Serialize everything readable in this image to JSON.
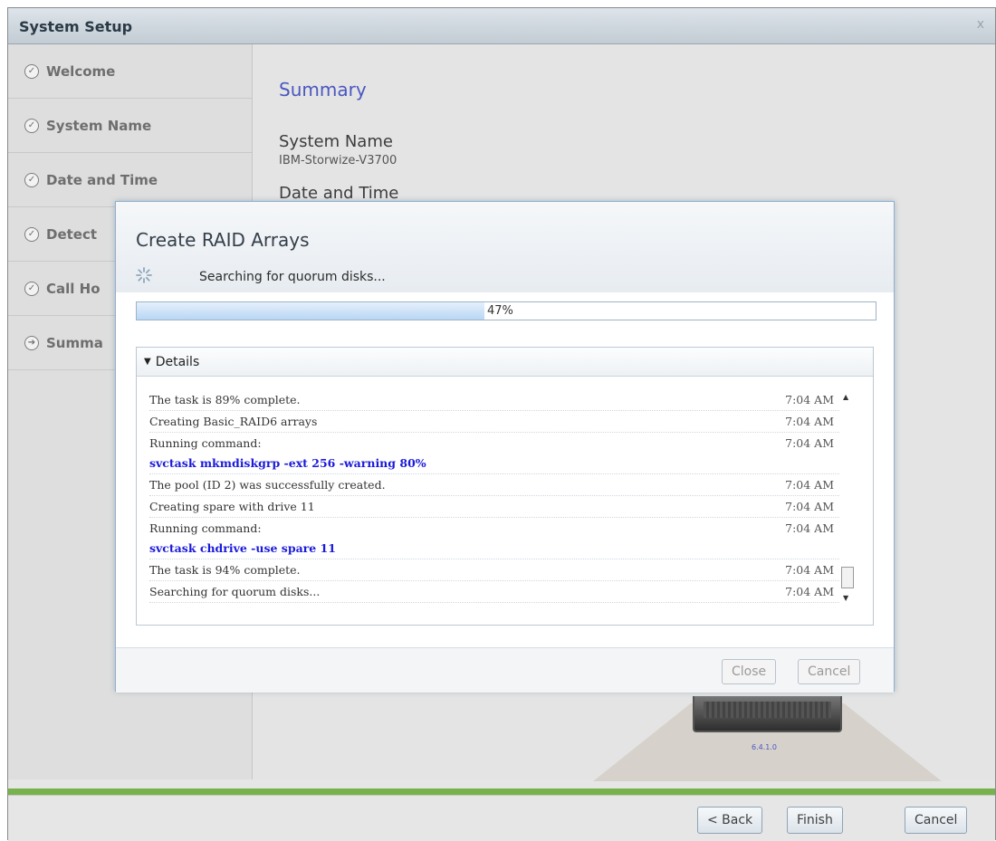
{
  "window": {
    "title": "System Setup",
    "close_glyph": "x"
  },
  "sidebar": {
    "steps": [
      {
        "label": "Welcome",
        "icon": "check-circle-icon",
        "glyph": "✓"
      },
      {
        "label": "System Name",
        "icon": "check-circle-icon",
        "glyph": "✓"
      },
      {
        "label": "Date and Time",
        "icon": "check-circle-icon",
        "glyph": "✓"
      },
      {
        "label": "Detect",
        "icon": "check-circle-icon",
        "glyph": "✓"
      },
      {
        "label": "Call Ho",
        "icon": "check-circle-icon",
        "glyph": "✓"
      },
      {
        "label": "Summa",
        "icon": "arrow-circle-icon",
        "glyph": "➔"
      }
    ]
  },
  "summary": {
    "title": "Summary",
    "system_name_heading": "System Name",
    "system_name_value": "IBM-Storwize-V3700",
    "date_time_heading": "Date and Time",
    "version_label": "6.4.1.0"
  },
  "dialog": {
    "title": "Create RAID Arrays",
    "status": "Searching for quorum disks...",
    "progress": 47,
    "progress_label": "47%",
    "details_label": "Details",
    "log": [
      {
        "text": "The task is 89% complete.",
        "time": "7:04 AM"
      },
      {
        "text": "Creating Basic_RAID6 arrays",
        "time": "7:04 AM"
      },
      {
        "text": "Running command:",
        "time": "7:04 AM",
        "command": "svctask mkmdiskgrp -ext 256 -warning 80%"
      },
      {
        "text": "The pool (ID 2) was successfully created.",
        "time": "7:04 AM"
      },
      {
        "text": "Creating spare with drive 11",
        "time": "7:04 AM"
      },
      {
        "text": "Running command:",
        "time": "7:04 AM",
        "command": "svctask chdrive -use spare 11"
      },
      {
        "text": "The task is 94% complete.",
        "time": "7:04 AM"
      },
      {
        "text": "Searching for quorum disks...",
        "time": "7:04 AM"
      }
    ],
    "close_label": "Close",
    "cancel_label": "Cancel"
  },
  "footer": {
    "back_label": "< Back",
    "finish_label": "Finish",
    "cancel_label": "Cancel"
  },
  "colors": {
    "accent": "#4a57c0",
    "command": "#1a1adb",
    "progress_strip": "#78b24d",
    "progress_fill": "#b9d6f4"
  }
}
